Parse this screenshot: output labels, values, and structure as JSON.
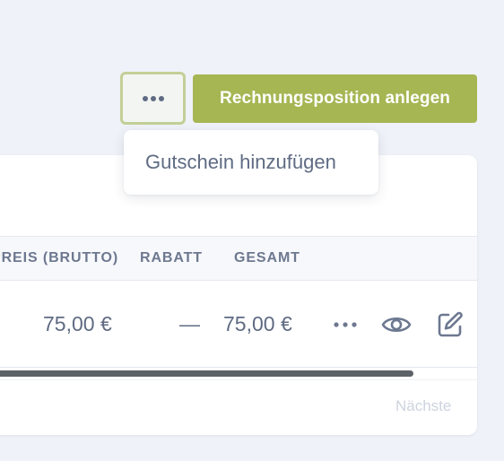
{
  "toolbar": {
    "more_icon": "more-horizontal-icon",
    "primary_label": "Rechnungsposition anlegen"
  },
  "dropdown": {
    "items": [
      {
        "label": "Gutschein hinzufügen"
      }
    ]
  },
  "table": {
    "columns": [
      {
        "label": "PREIS (BRUTTO)"
      },
      {
        "label": "RABATT"
      },
      {
        "label": "GESAMT"
      }
    ],
    "rows": [
      {
        "price": "75,00 €",
        "discount": "—",
        "total": "75,00 €",
        "actions": [
          "more-horizontal-icon",
          "eye-icon",
          "edit-icon"
        ]
      }
    ]
  },
  "pagination": {
    "next_label": "Nächste"
  },
  "colors": {
    "background": "#eff2f8",
    "primary": "#a5b653",
    "primary_outline": "#c3cf97",
    "text": "#5f6b83",
    "muted": "#cdd3de"
  }
}
